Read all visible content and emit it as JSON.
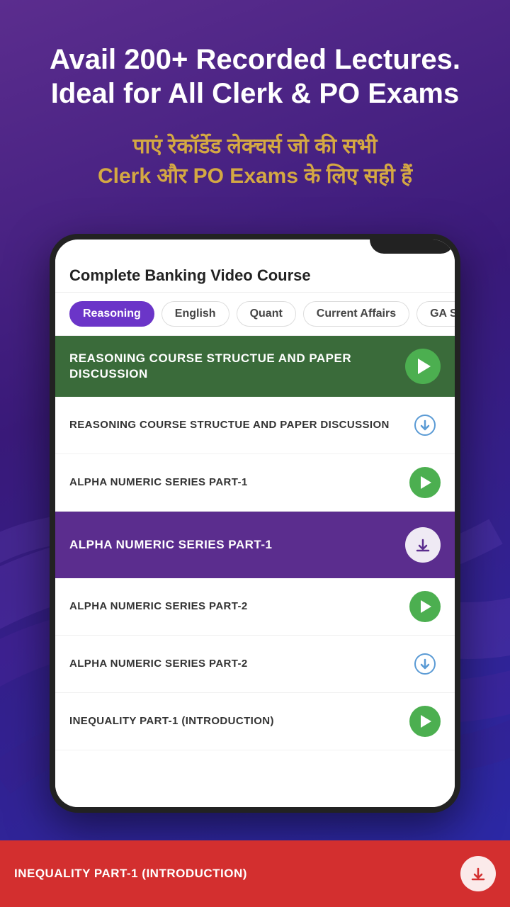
{
  "hero": {
    "title": "Avail 200+ Recorded Lectures. Ideal for All Clerk & PO Exams",
    "subtitle_hindi": "पाएं रेकॉर्डेड लेक्चर्स जो की सभी",
    "subtitle_hindi2": "Clerk और PO Exams के लिए सही हैं"
  },
  "course": {
    "title": "Complete Banking Video Course",
    "tabs": [
      {
        "label": "Reasoning",
        "active": true
      },
      {
        "label": "English",
        "active": false
      },
      {
        "label": "Quant",
        "active": false
      },
      {
        "label": "Current Affairs",
        "active": false
      },
      {
        "label": "GA Sta...",
        "active": false
      }
    ]
  },
  "highlighted_green": {
    "text": "REASONING COURSE STRUCTUE AND PAPER DISCUSSION",
    "type": "play"
  },
  "list_items": [
    {
      "text": "REASONING COURSE STRUCTUE AND PAPER DISCUSSION",
      "type": "download"
    },
    {
      "text": "ALPHA NUMERIC SERIES PART-1",
      "type": "play"
    }
  ],
  "highlighted_purple": {
    "text": "ALPHA NUMERIC SERIES PART-1",
    "type": "download"
  },
  "list_items2": [
    {
      "text": "ALPHA NUMERIC SERIES PART-2",
      "type": "play"
    },
    {
      "text": "ALPHA NUMERIC SERIES PART-2",
      "type": "download"
    },
    {
      "text": "INEQUALITY PART-1 (INTRODUCTION)",
      "type": "play"
    }
  ],
  "highlighted_red": {
    "text": "INEQUALITY PART-1 (INTRODUCTION)",
    "type": "download"
  },
  "icons": {
    "play": "▶",
    "download": "⬇"
  }
}
